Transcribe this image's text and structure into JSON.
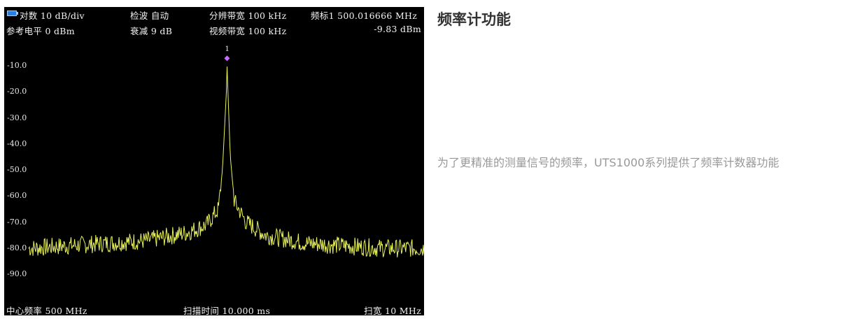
{
  "analyzer": {
    "header_row1": {
      "scale": "对数 10 dB/div",
      "detector": "检波 自动",
      "rbw": "分辨带宽 100 kHz",
      "marker_freq": "频标1  500.016666 MHz"
    },
    "header_row2": {
      "ref_level": "参考电平 0 dBm",
      "attenuation": "衰减 9 dB",
      "vbw": "视频带宽 100 kHz",
      "marker_level": "-9.83 dBm"
    },
    "footer": {
      "center_freq": "中心频率 500 MHz",
      "sweep_time": "扫描时间 10.000 ms",
      "span": "扫宽 10 MHz"
    },
    "marker_number": "1",
    "colors": {
      "trace": "#e8f25a",
      "marker": "#c86cff",
      "background": "#000000"
    }
  },
  "chart_data": {
    "type": "line",
    "xlabel": "",
    "ylabel": "",
    "x_range_mhz": [
      495,
      505
    ],
    "ylim": [
      -100,
      0
    ],
    "y_ticks": [
      "-10.0",
      "-20.0",
      "-30.0",
      "-40.0",
      "-50.0",
      "-60.0",
      "-70.0",
      "-80.0",
      "-90.0"
    ],
    "peak": {
      "x_mhz": 500.016666,
      "y_dbm": -9.83
    },
    "noise_floor_dbm": -80,
    "series": [
      {
        "x": [
          495,
          496,
          497,
          498,
          499,
          499.5,
          499.8,
          499.9,
          500,
          500.016666,
          500.1,
          500.2,
          500.5,
          501,
          502,
          503,
          504,
          505
        ],
        "y": [
          -80,
          -79,
          -78,
          -77,
          -74,
          -71,
          -65,
          -50,
          -20,
          -9.83,
          -45,
          -62,
          -70,
          -75,
          -78,
          -79,
          -80,
          -80
        ]
      }
    ]
  },
  "content": {
    "title": "频率计功能",
    "description": "为了更精准的测量信号的频率，UTS1000系列提供了频率计数器功能"
  }
}
